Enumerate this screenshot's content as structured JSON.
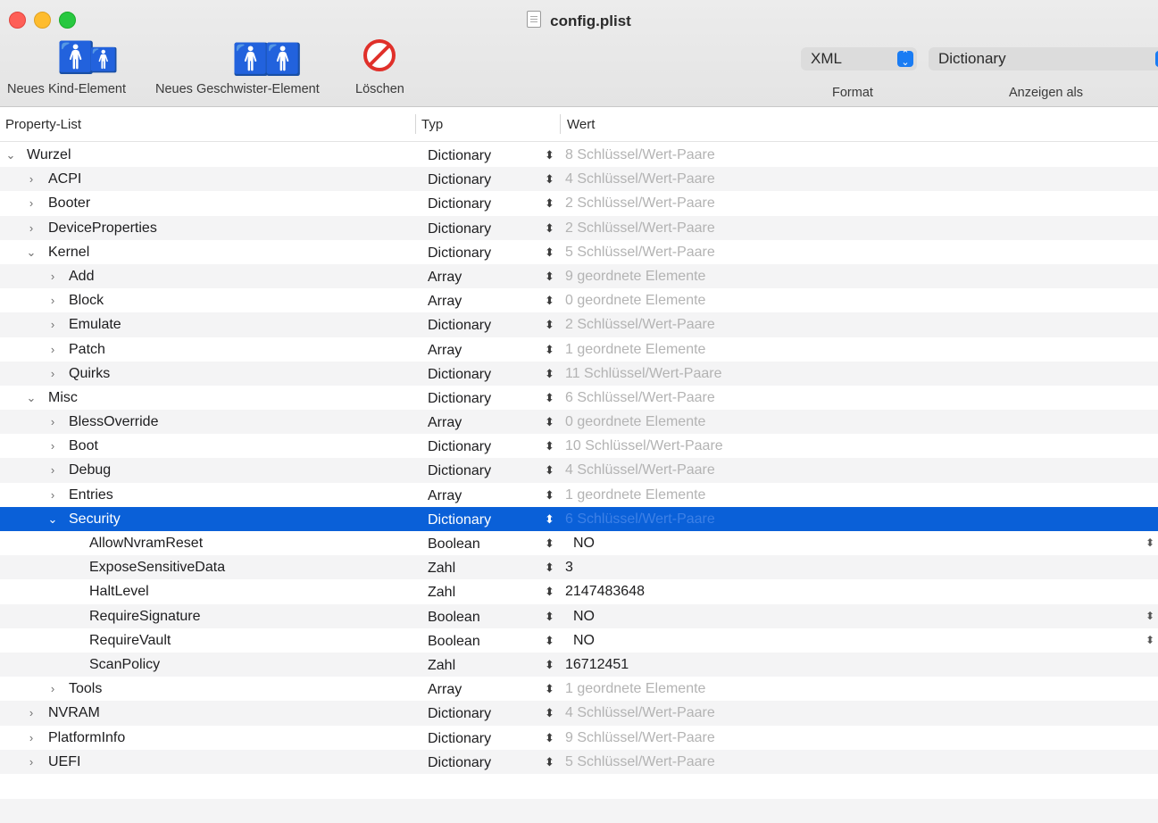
{
  "window": {
    "title": "config.plist"
  },
  "toolbar": {
    "new_child_label": "Neues Kind-Element",
    "new_sibling_label": "Neues Geschwister-Element",
    "delete_label": "Löschen",
    "format_value": "XML",
    "format_caption": "Format",
    "view_as_value": "Dictionary",
    "view_as_caption": "Anzeigen als"
  },
  "columns": {
    "key": "Property-List",
    "type": "Typ",
    "value": "Wert"
  },
  "rows": [
    {
      "key": "Wurzel",
      "type": "Dictionary",
      "value": "8 Schlüssel/Wert-Paare"
    },
    {
      "key": "ACPI",
      "type": "Dictionary",
      "value": "4 Schlüssel/Wert-Paare"
    },
    {
      "key": "Booter",
      "type": "Dictionary",
      "value": "2 Schlüssel/Wert-Paare"
    },
    {
      "key": "DeviceProperties",
      "type": "Dictionary",
      "value": "2 Schlüssel/Wert-Paare"
    },
    {
      "key": "Kernel",
      "type": "Dictionary",
      "value": "5 Schlüssel/Wert-Paare"
    },
    {
      "key": "Add",
      "type": "Array",
      "value": "9 geordnete Elemente"
    },
    {
      "key": "Block",
      "type": "Array",
      "value": "0 geordnete Elemente"
    },
    {
      "key": "Emulate",
      "type": "Dictionary",
      "value": "2 Schlüssel/Wert-Paare"
    },
    {
      "key": "Patch",
      "type": "Array",
      "value": "1 geordnete Elemente"
    },
    {
      "key": "Quirks",
      "type": "Dictionary",
      "value": "11 Schlüssel/Wert-Paare"
    },
    {
      "key": "Misc",
      "type": "Dictionary",
      "value": "6 Schlüssel/Wert-Paare"
    },
    {
      "key": "BlessOverride",
      "type": "Array",
      "value": "0 geordnete Elemente"
    },
    {
      "key": "Boot",
      "type": "Dictionary",
      "value": "10 Schlüssel/Wert-Paare"
    },
    {
      "key": "Debug",
      "type": "Dictionary",
      "value": "4 Schlüssel/Wert-Paare"
    },
    {
      "key": "Entries",
      "type": "Array",
      "value": "1 geordnete Elemente"
    },
    {
      "key": "Security",
      "type": "Dictionary",
      "value": "6 Schlüssel/Wert-Paare"
    },
    {
      "key": "AllowNvramReset",
      "type": "Boolean",
      "value": "NO"
    },
    {
      "key": "ExposeSensitiveData",
      "type": "Zahl",
      "value": "3"
    },
    {
      "key": "HaltLevel",
      "type": "Zahl",
      "value": "2147483648"
    },
    {
      "key": "RequireSignature",
      "type": "Boolean",
      "value": "NO"
    },
    {
      "key": "RequireVault",
      "type": "Boolean",
      "value": "NO"
    },
    {
      "key": "ScanPolicy",
      "type": "Zahl",
      "value": "16712451"
    },
    {
      "key": "Tools",
      "type": "Array",
      "value": "1 geordnete Elemente"
    },
    {
      "key": "NVRAM",
      "type": "Dictionary",
      "value": "4 Schlüssel/Wert-Paare"
    },
    {
      "key": "PlatformInfo",
      "type": "Dictionary",
      "value": "9 Schlüssel/Wert-Paare"
    },
    {
      "key": "UEFI",
      "type": "Dictionary",
      "value": "5 Schlüssel/Wert-Paare"
    }
  ],
  "colors": {
    "selection": "#0a60d8",
    "accent": "#1a7cf3"
  }
}
